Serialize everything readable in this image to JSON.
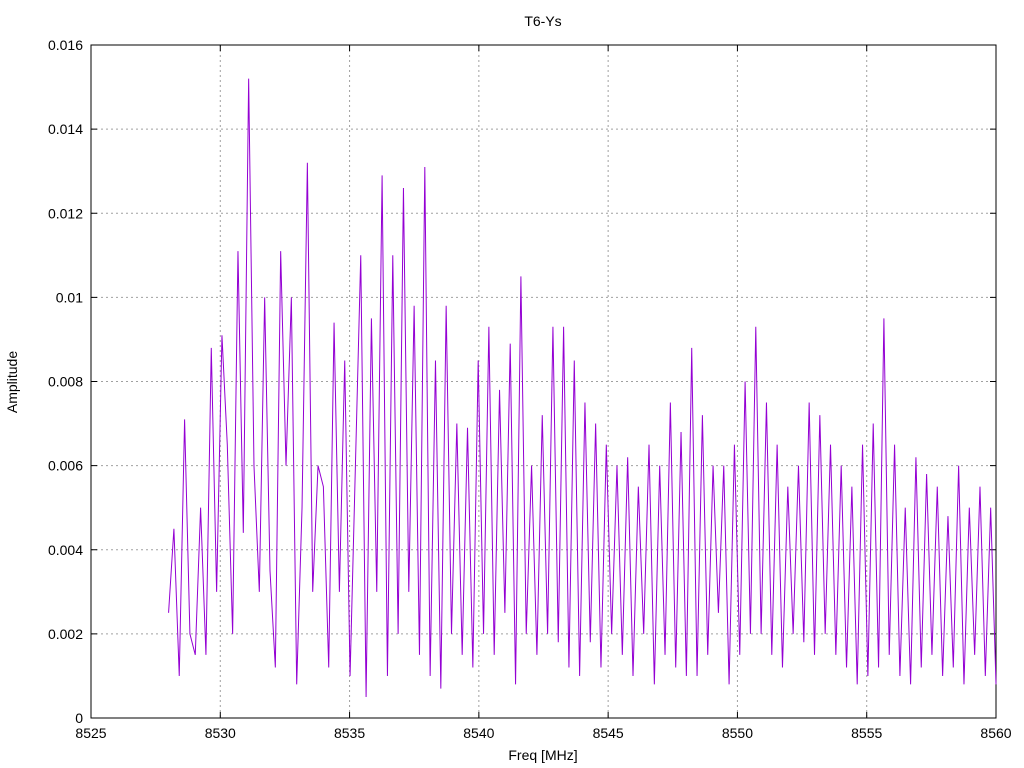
{
  "chart_data": {
    "type": "line",
    "title": "T6-Ys",
    "xlabel": "Freq [MHz]",
    "ylabel": "Amplitude",
    "xlim": [
      8525,
      8560
    ],
    "ylim": [
      0,
      0.016
    ],
    "xticks": [
      8525,
      8530,
      8535,
      8540,
      8545,
      8550,
      8555,
      8560
    ],
    "xtick_labels": [
      "8525",
      "8530",
      "8535",
      "8540",
      "8545",
      "8550",
      "8555",
      "8560"
    ],
    "yticks": [
      0,
      0.002,
      0.004,
      0.006,
      0.008,
      0.01,
      0.012,
      0.014,
      0.016
    ],
    "ytick_labels": [
      "0",
      "0.002",
      "0.004",
      "0.006",
      "0.008",
      "0.01",
      "0.012",
      "0.014",
      "0.016"
    ],
    "grid": true,
    "line_color": "#9400d3",
    "series": [
      {
        "x_start": 8528.0,
        "x_end": 8560.0,
        "x_step": 0.2,
        "values": [
          0.0025,
          0.0045,
          0.001,
          0.0071,
          0.002,
          0.0015,
          0.005,
          0.0015,
          0.0088,
          0.003,
          0.0091,
          0.0065,
          0.002,
          0.0111,
          0.0044,
          0.0152,
          0.006,
          0.003,
          0.01,
          0.0035,
          0.0012,
          0.0111,
          0.006,
          0.01,
          0.0008,
          0.005,
          0.0132,
          0.003,
          0.006,
          0.0055,
          0.0012,
          0.0094,
          0.003,
          0.0085,
          0.001,
          0.006,
          0.011,
          0.0005,
          0.0095,
          0.003,
          0.0129,
          0.001,
          0.011,
          0.002,
          0.0126,
          0.003,
          0.0098,
          0.0015,
          0.0131,
          0.001,
          0.0085,
          0.0007,
          0.0098,
          0.002,
          0.007,
          0.0015,
          0.0069,
          0.0012,
          0.0085,
          0.002,
          0.0093,
          0.0015,
          0.0078,
          0.0025,
          0.0089,
          0.0008,
          0.0105,
          0.002,
          0.006,
          0.0015,
          0.0072,
          0.002,
          0.0093,
          0.0018,
          0.0093,
          0.0012,
          0.0085,
          0.001,
          0.0075,
          0.0018,
          0.007,
          0.0012,
          0.0065,
          0.002,
          0.006,
          0.0015,
          0.0062,
          0.001,
          0.0055,
          0.002,
          0.0065,
          0.0008,
          0.006,
          0.0015,
          0.0075,
          0.0012,
          0.0068,
          0.001,
          0.0088,
          0.001,
          0.0072,
          0.0015,
          0.006,
          0.0025,
          0.006,
          0.0008,
          0.0065,
          0.0015,
          0.008,
          0.002,
          0.0093,
          0.002,
          0.0075,
          0.0015,
          0.0065,
          0.0012,
          0.0055,
          0.002,
          0.006,
          0.0018,
          0.0075,
          0.0015,
          0.0072,
          0.002,
          0.0065,
          0.0015,
          0.006,
          0.0012,
          0.0055,
          0.0008,
          0.0065,
          0.001,
          0.007,
          0.0012,
          0.0095,
          0.0015,
          0.0065,
          0.001,
          0.005,
          0.0008,
          0.0062,
          0.0012,
          0.0058,
          0.0015,
          0.0055,
          0.001,
          0.0048,
          0.0012,
          0.006,
          0.0008,
          0.005,
          0.0015,
          0.0055,
          0.001,
          0.005,
          0.0008
        ]
      }
    ]
  }
}
